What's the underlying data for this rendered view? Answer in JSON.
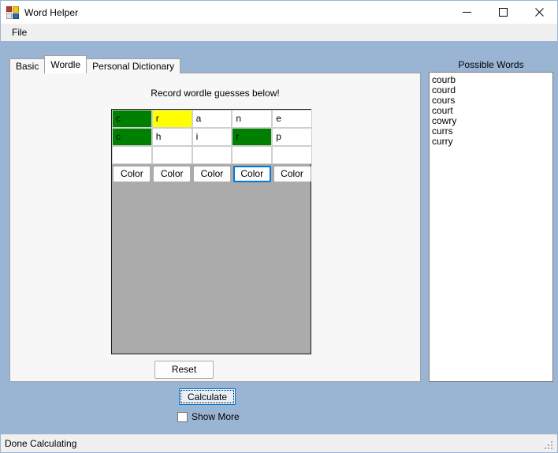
{
  "window": {
    "title": "Word Helper",
    "icon": "app-icon",
    "buttons": {
      "minimize": "minimize-icon",
      "maximize": "maximize-icon",
      "close": "close-icon"
    }
  },
  "menu": {
    "items": [
      {
        "label": "File"
      }
    ]
  },
  "tabs": [
    {
      "label": "Basic",
      "selected": false
    },
    {
      "label": "Wordle",
      "selected": true
    },
    {
      "label": "Personal Dictionary",
      "selected": false
    }
  ],
  "wordle": {
    "heading": "Record wordle guesses below!",
    "grid": {
      "rows": [
        [
          {
            "letter": "c",
            "state": "green"
          },
          {
            "letter": "r",
            "state": "yellow"
          },
          {
            "letter": "a",
            "state": "none"
          },
          {
            "letter": "n",
            "state": "none"
          },
          {
            "letter": "e",
            "state": "none"
          }
        ],
        [
          {
            "letter": "c",
            "state": "green"
          },
          {
            "letter": "h",
            "state": "none"
          },
          {
            "letter": "i",
            "state": "none"
          },
          {
            "letter": "r",
            "state": "green"
          },
          {
            "letter": "p",
            "state": "none"
          }
        ],
        [
          {
            "letter": "",
            "state": "none"
          },
          {
            "letter": "",
            "state": "none"
          },
          {
            "letter": "",
            "state": "none"
          },
          {
            "letter": "",
            "state": "none"
          },
          {
            "letter": "",
            "state": "none"
          }
        ]
      ]
    },
    "color_buttons": [
      {
        "label": "Color",
        "focused": false
      },
      {
        "label": "Color",
        "focused": false
      },
      {
        "label": "Color",
        "focused": false
      },
      {
        "label": "Color",
        "focused": true
      },
      {
        "label": "Color",
        "focused": false
      }
    ],
    "reset_label": "Reset"
  },
  "possible_words": {
    "label": "Possible Words",
    "items": [
      "courb",
      "courd",
      "cours",
      "court",
      "cowry",
      "currs",
      "curry"
    ]
  },
  "actions": {
    "calculate_label": "Calculate",
    "show_more_label": "Show More",
    "show_more_checked": false
  },
  "statusbar": {
    "text": "Done Calculating"
  },
  "colors": {
    "window_bg": "#9ab5d4",
    "panel_bg": "#f7f7f7",
    "board_bg": "#ababab",
    "correct": "#008000",
    "present": "#ffff00",
    "absent": "#ffffff",
    "accent": "#0078d7"
  }
}
